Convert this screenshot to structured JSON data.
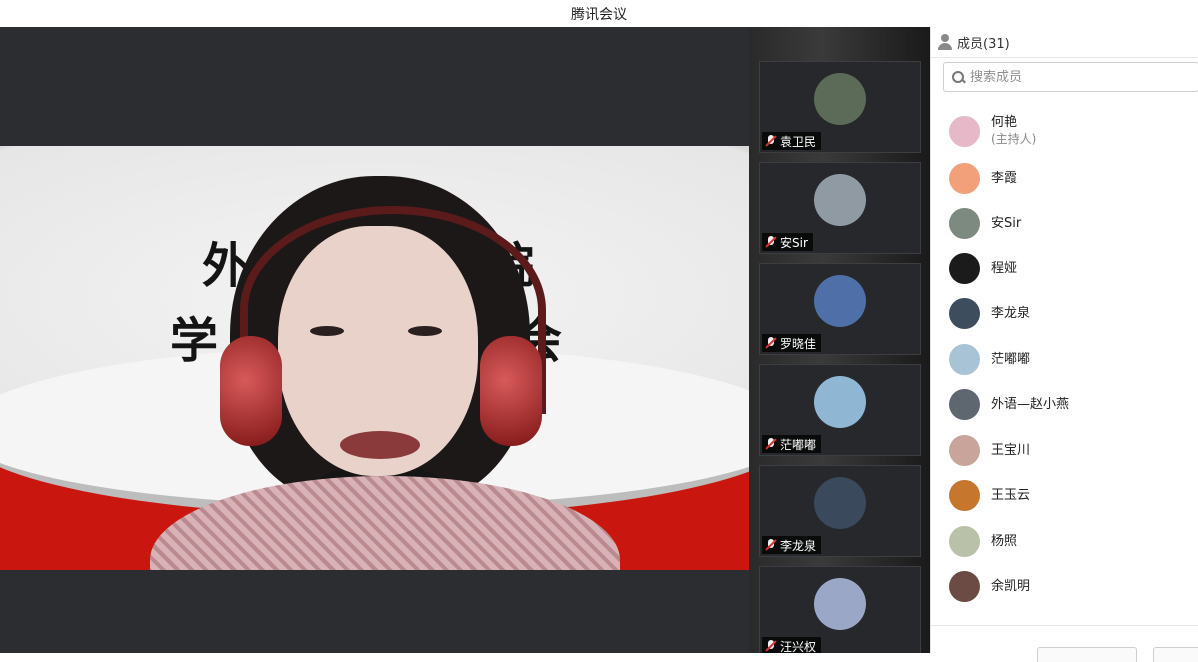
{
  "window": {
    "title": "腾讯会议"
  },
  "main_video": {
    "banner_line1": "外",
    "banner_line1b": "院",
    "banner_line2": "学",
    "banner_line2b": "会"
  },
  "thumbnails": [
    {
      "name": "袁卫民",
      "avatar_color": "#5b6b57"
    },
    {
      "name": "安Sir",
      "avatar_color": "#8f9aa3"
    },
    {
      "name": "罗晓佳",
      "avatar_color": "#4f6fa8"
    },
    {
      "name": "茫嘟嘟",
      "avatar_color": "#8fb7d3"
    },
    {
      "name": "李龙泉",
      "avatar_color": "#3a4a5c"
    },
    {
      "name": "汪兴权",
      "avatar_color": "#9aa7c7"
    }
  ],
  "members_panel": {
    "title": "成员(31)",
    "search_placeholder": "搜索成员",
    "members": [
      {
        "name": "何艳",
        "role": "(主持人)",
        "avatar_color": "#e7b8c8"
      },
      {
        "name": "李霞",
        "role": "",
        "avatar_color": "#f2a07a"
      },
      {
        "name": "安Sir",
        "role": "",
        "avatar_color": "#7c8a80"
      },
      {
        "name": "程娅",
        "role": "",
        "avatar_color": "#1b1b1b"
      },
      {
        "name": "李龙泉",
        "role": "",
        "avatar_color": "#3e4d5d"
      },
      {
        "name": "茫嘟嘟",
        "role": "",
        "avatar_color": "#a9c3d6"
      },
      {
        "name": "外语—赵小燕",
        "role": "",
        "avatar_color": "#5e6670"
      },
      {
        "name": "王宝川",
        "role": "",
        "avatar_color": "#c8a49a"
      },
      {
        "name": "王玉云",
        "role": "",
        "avatar_color": "#c7762d"
      },
      {
        "name": "杨照",
        "role": "",
        "avatar_color": "#b9c2a9"
      },
      {
        "name": "余凯明",
        "role": "",
        "avatar_color": "#6b4b44"
      }
    ]
  }
}
